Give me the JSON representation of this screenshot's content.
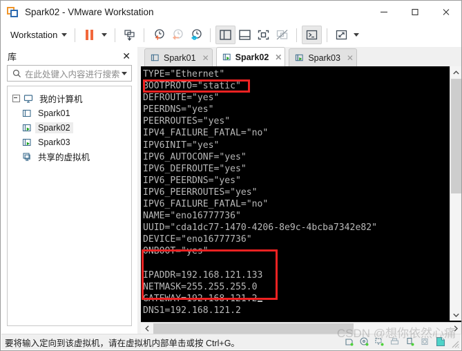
{
  "window": {
    "title": "Spark02 - VMware Workstation",
    "app_icon": "vmware-logo-icon",
    "minimize_label": "—",
    "maximize_label": "□",
    "close_label": "✕"
  },
  "toolbar": {
    "menu_label": "Workstation",
    "buttons": [
      {
        "name": "suspend-button",
        "icon": "pause-icon"
      },
      {
        "name": "power-dropdown",
        "icon": "chevron-down-icon"
      },
      {
        "name": "install-tools-button",
        "icon": "download-vm-icon"
      },
      {
        "name": "take-snapshot-button",
        "icon": "snapshot-add-icon"
      },
      {
        "name": "revert-snapshot-button",
        "icon": "snapshot-revert-icon"
      },
      {
        "name": "manage-snapshots-button",
        "icon": "snapshot-manage-icon"
      },
      {
        "name": "show-library-button",
        "icon": "sidebar-panel-icon"
      },
      {
        "name": "show-thumbnails-button",
        "icon": "bottom-panel-icon"
      },
      {
        "name": "full-screen-button",
        "icon": "fullscreen-icon"
      },
      {
        "name": "unity-mode-button",
        "icon": "unity-mode-icon"
      },
      {
        "name": "console-view-button",
        "icon": "terminal-icon"
      },
      {
        "name": "stretch-button",
        "icon": "expand-arrows-icon"
      },
      {
        "name": "stretch-dropdown",
        "icon": "chevron-down-icon"
      }
    ]
  },
  "library": {
    "title": "库",
    "close_label": "✕",
    "search": {
      "placeholder": "在此处键入内容进行搜索",
      "value": "",
      "icon": "search-icon",
      "dropdown_icon": "chevron-down-icon"
    },
    "tree": [
      {
        "label": "我的计算机",
        "icon": "computer-icon",
        "level": 0,
        "expanded": true,
        "selected": false
      },
      {
        "label": "Spark01",
        "icon": "vm-stopped-icon",
        "level": 1,
        "expanded": false,
        "selected": false
      },
      {
        "label": "Spark02",
        "icon": "vm-running-icon",
        "level": 1,
        "expanded": false,
        "selected": true
      },
      {
        "label": "Spark03",
        "icon": "vm-running-icon",
        "level": 1,
        "expanded": false,
        "selected": false
      },
      {
        "label": "共享的虚拟机",
        "icon": "shared-vm-icon",
        "level": 0,
        "expanded": false,
        "selected": false
      }
    ]
  },
  "tabs": [
    {
      "label": "Spark01",
      "icon": "vm-stopped-icon",
      "active": false,
      "close_label": "✕"
    },
    {
      "label": "Spark02",
      "icon": "vm-running-icon",
      "active": true,
      "close_label": "✕"
    },
    {
      "label": "Spark03",
      "icon": "vm-running-icon",
      "active": false,
      "close_label": "✕"
    }
  ],
  "terminal": {
    "background": "#000000",
    "foreground": "#b9b9b9",
    "lines": [
      "TYPE=\"Ethernet\"",
      "BOOTPROTO=\"static\"",
      "DEFROUTE=\"yes\"",
      "PEERDNS=\"yes\"",
      "PEERROUTES=\"yes\"",
      "IPV4_FAILURE_FATAL=\"no\"",
      "IPV6INIT=\"yes\"",
      "IPV6_AUTOCONF=\"yes\"",
      "IPV6_DEFROUTE=\"yes\"",
      "IPV6_PEERDNS=\"yes\"",
      "IPV6_PEERROUTES=\"yes\"",
      "IPV6_FAILURE_FATAL=\"no\"",
      "NAME=\"eno16777736\"",
      "UUID=\"cda1dc77-1470-4206-8e9c-4bcba7342e82\"",
      "DEVICE=\"eno16777736\"",
      "ONBOOT=\"yes\"",
      "",
      "IPADDR=192.168.121.133",
      "NETMASK=255.255.255.0",
      "GATEWAY=192.168.121.2",
      "DNS1=192.168.121.2"
    ],
    "cursor_line_index": 19,
    "tilde_lines": [
      "~",
      "~"
    ],
    "annotations": [
      {
        "name": "bootproto-highlight",
        "color": "#ee2222",
        "target_line": 1
      },
      {
        "name": "static-ip-block-highlight",
        "color": "#ee2222",
        "target_lines": [
          17,
          18,
          19,
          20
        ]
      }
    ]
  },
  "scrollbars": {
    "vertical": {
      "up_icon": "chevron-up-icon",
      "down_icon": "chevron-down-icon"
    },
    "horizontal": {
      "left_icon": "chevron-left-icon",
      "right_icon": "chevron-right-icon"
    }
  },
  "statusbar": {
    "message": "要将输入定向到该虚拟机，请在虚拟机内部单击或按 Ctrl+G。",
    "icons": [
      {
        "name": "status-harddisk-icon"
      },
      {
        "name": "status-cdrom-icon"
      },
      {
        "name": "status-network-icon"
      },
      {
        "name": "status-printer-icon"
      },
      {
        "name": "status-usb-icon"
      },
      {
        "name": "status-sound-icon"
      },
      {
        "name": "status-display-icon"
      }
    ],
    "resize_grip_icon": "resize-grip-icon"
  },
  "watermark": {
    "text": "CSDN @想你依然心痛"
  }
}
